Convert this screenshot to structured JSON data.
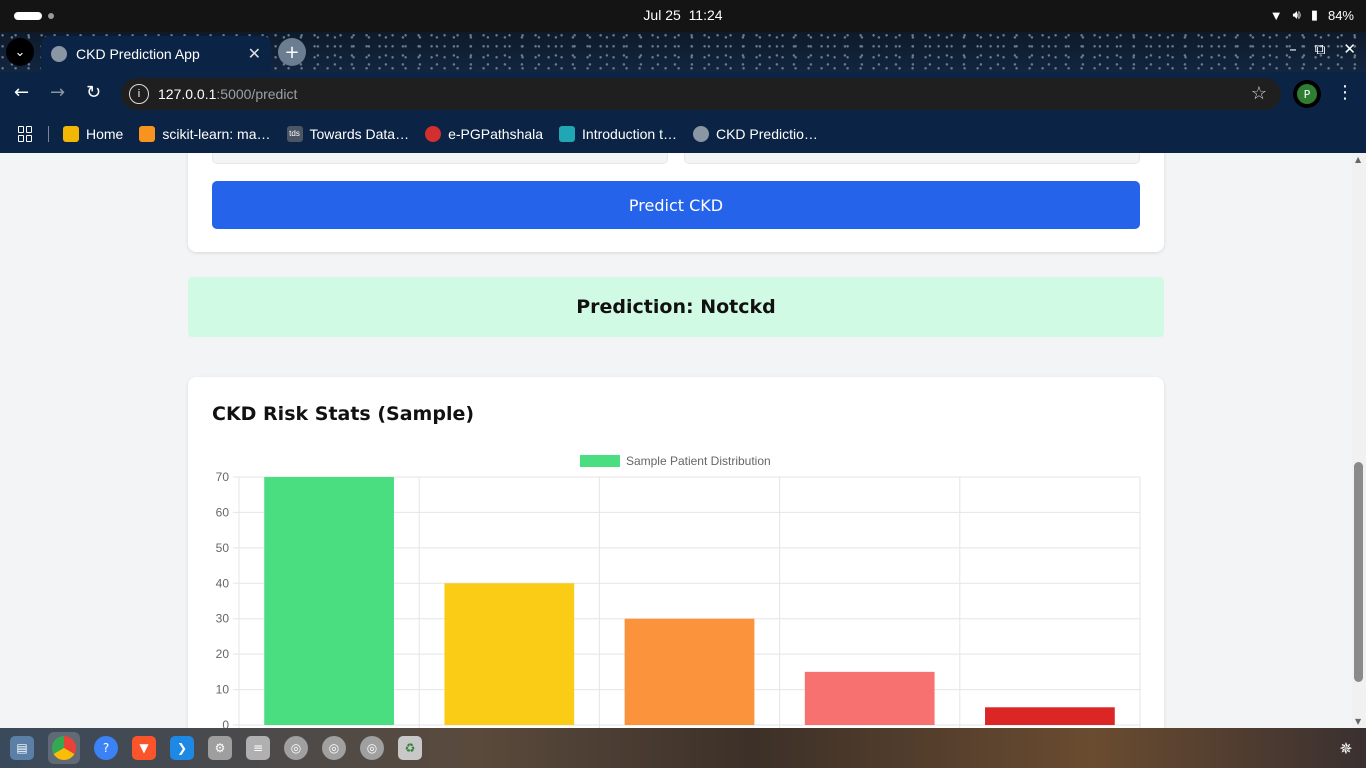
{
  "os": {
    "date": "Jul 25",
    "time": "11:24",
    "battery": "84%"
  },
  "browser": {
    "tab_title": "CKD Prediction App",
    "url_host": "127.0.0.1",
    "url_path": ":5000/predict",
    "profile_initial": "P",
    "bookmarks": [
      {
        "label": "Home",
        "color": "#f2b705"
      },
      {
        "label": "scikit-learn: ma…",
        "color": "#f7931e"
      },
      {
        "label": "Towards Data…",
        "color": "#4b5563"
      },
      {
        "label": "e-PGPathshala",
        "color": "#d32f2f"
      },
      {
        "label": "Introduction t…",
        "color": "#1fa8b3"
      },
      {
        "label": "CKD Predictio…",
        "color": "#8a96a4"
      }
    ]
  },
  "page": {
    "predict_button": "Predict CKD",
    "prediction_text": "Prediction: Notckd",
    "chart_card_title": "CKD Risk Stats (Sample)"
  },
  "chart_data": {
    "type": "bar",
    "title": "",
    "categories": [
      "",
      "",
      "",
      "",
      ""
    ],
    "series": [
      {
        "name": "Sample Patient Distribution",
        "values": [
          70,
          40,
          30,
          15,
          5
        ],
        "colors": [
          "#4ade80",
          "#facc15",
          "#fb923c",
          "#f87171",
          "#dc2626"
        ],
        "legend_color": "#4ade80"
      }
    ],
    "ylim": [
      0,
      70
    ],
    "yticks": [
      0,
      10,
      20,
      30,
      40,
      50,
      60,
      70
    ],
    "grid": true,
    "legend_position": "top-center"
  },
  "taskbar": {
    "apps": [
      "files-icon",
      "chrome-icon",
      "help-icon",
      "brave-icon",
      "vscode-icon",
      "settings-icon",
      "archive-icon",
      "disk-icon",
      "disk-icon",
      "disk-icon",
      "recycle-icon"
    ]
  }
}
